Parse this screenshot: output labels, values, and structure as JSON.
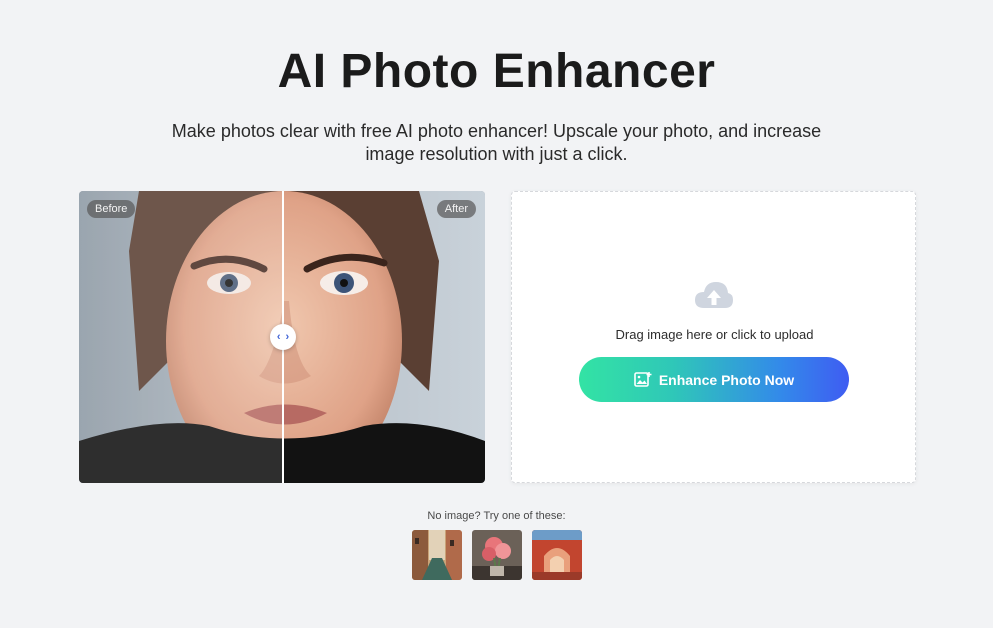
{
  "header": {
    "title": "AI Photo Enhancer",
    "subtitle": "Make photos clear with free AI photo enhancer! Upscale your photo, and increase image resolution with just a click."
  },
  "compare": {
    "before_label": "Before",
    "after_label": "After",
    "handle_left": "‹",
    "handle_right": "›"
  },
  "upload": {
    "icon": "cloud-upload-icon",
    "drag_text": "Drag image here or click to upload",
    "button_label": "Enhance Photo Now",
    "button_icon": "image-add-icon"
  },
  "samples": {
    "label": "No image? Try one of these:",
    "items": [
      {
        "name": "sample-venice-canal"
      },
      {
        "name": "sample-pink-flowers"
      },
      {
        "name": "sample-red-archway"
      }
    ]
  },
  "colors": {
    "background": "#f2f3f5",
    "button_gradient_start": "#33e3a4",
    "button_gradient_end": "#3f5cf2",
    "handle_arrows": "#3f63d6"
  }
}
